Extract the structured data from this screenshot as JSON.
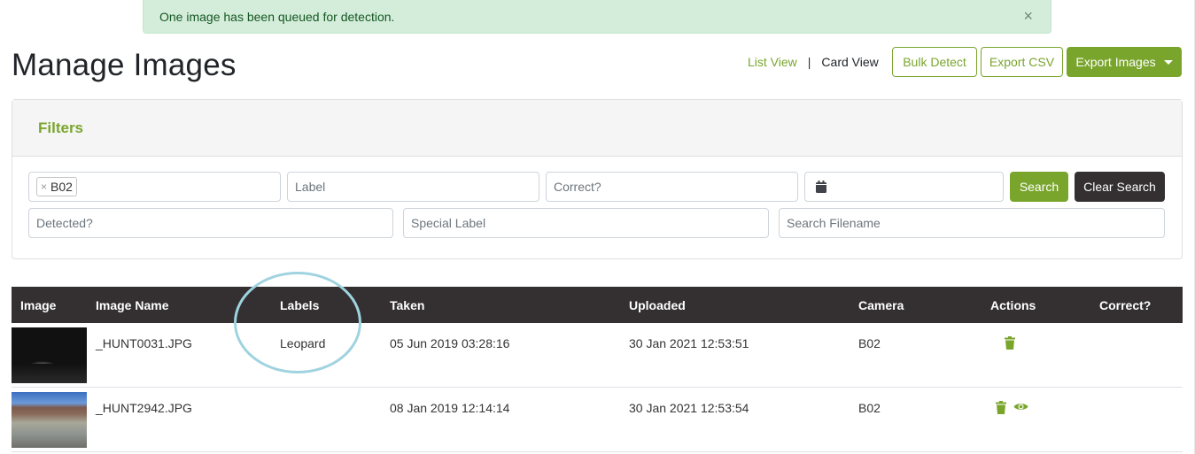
{
  "alert": {
    "message": "One image has been queued for detection.",
    "close_label": "×"
  },
  "page_title": "Manage Images",
  "view_toggle": {
    "list_view": "List View",
    "separator": "|",
    "card_view": "Card View"
  },
  "toolbar": {
    "bulk_detect": "Bulk Detect",
    "export_csv": "Export CSV",
    "export_images": "Export Images"
  },
  "filters": {
    "title": "Filters",
    "camera_tag": "B02",
    "camera_tag_remove": "×",
    "label_placeholder": "Label",
    "correct_placeholder": "Correct?",
    "date_value": "",
    "detected_placeholder": "Detected?",
    "special_label_placeholder": "Special Label",
    "filename_placeholder": "Search Filename",
    "search_button": "Search",
    "clear_search_button": "Clear Search"
  },
  "table": {
    "columns": [
      "Image",
      "Image Name",
      "Labels",
      "Taken",
      "Uploaded",
      "Camera",
      "Actions",
      "Correct?"
    ],
    "rows": [
      {
        "image_name": "_HUNT0031.JPG",
        "labels": "Leopard",
        "taken": "05 Jun 2019 03:28:16",
        "uploaded": "30 Jan 2021 12:53:51",
        "camera": "B02",
        "actions": [
          "trash-icon"
        ],
        "correct": ""
      },
      {
        "image_name": "_HUNT2942.JPG",
        "labels": "",
        "taken": "08 Jan 2019 12:14:14",
        "uploaded": "30 Jan 2021 12:53:54",
        "camera": "B02",
        "actions": [
          "trash-icon",
          "eye-icon"
        ],
        "correct": ""
      }
    ]
  },
  "colors": {
    "brand_green": "#7aa52d",
    "dark": "#343031",
    "alert_bg": "#d4edda",
    "annotation_circle": "#9fd3e0"
  }
}
